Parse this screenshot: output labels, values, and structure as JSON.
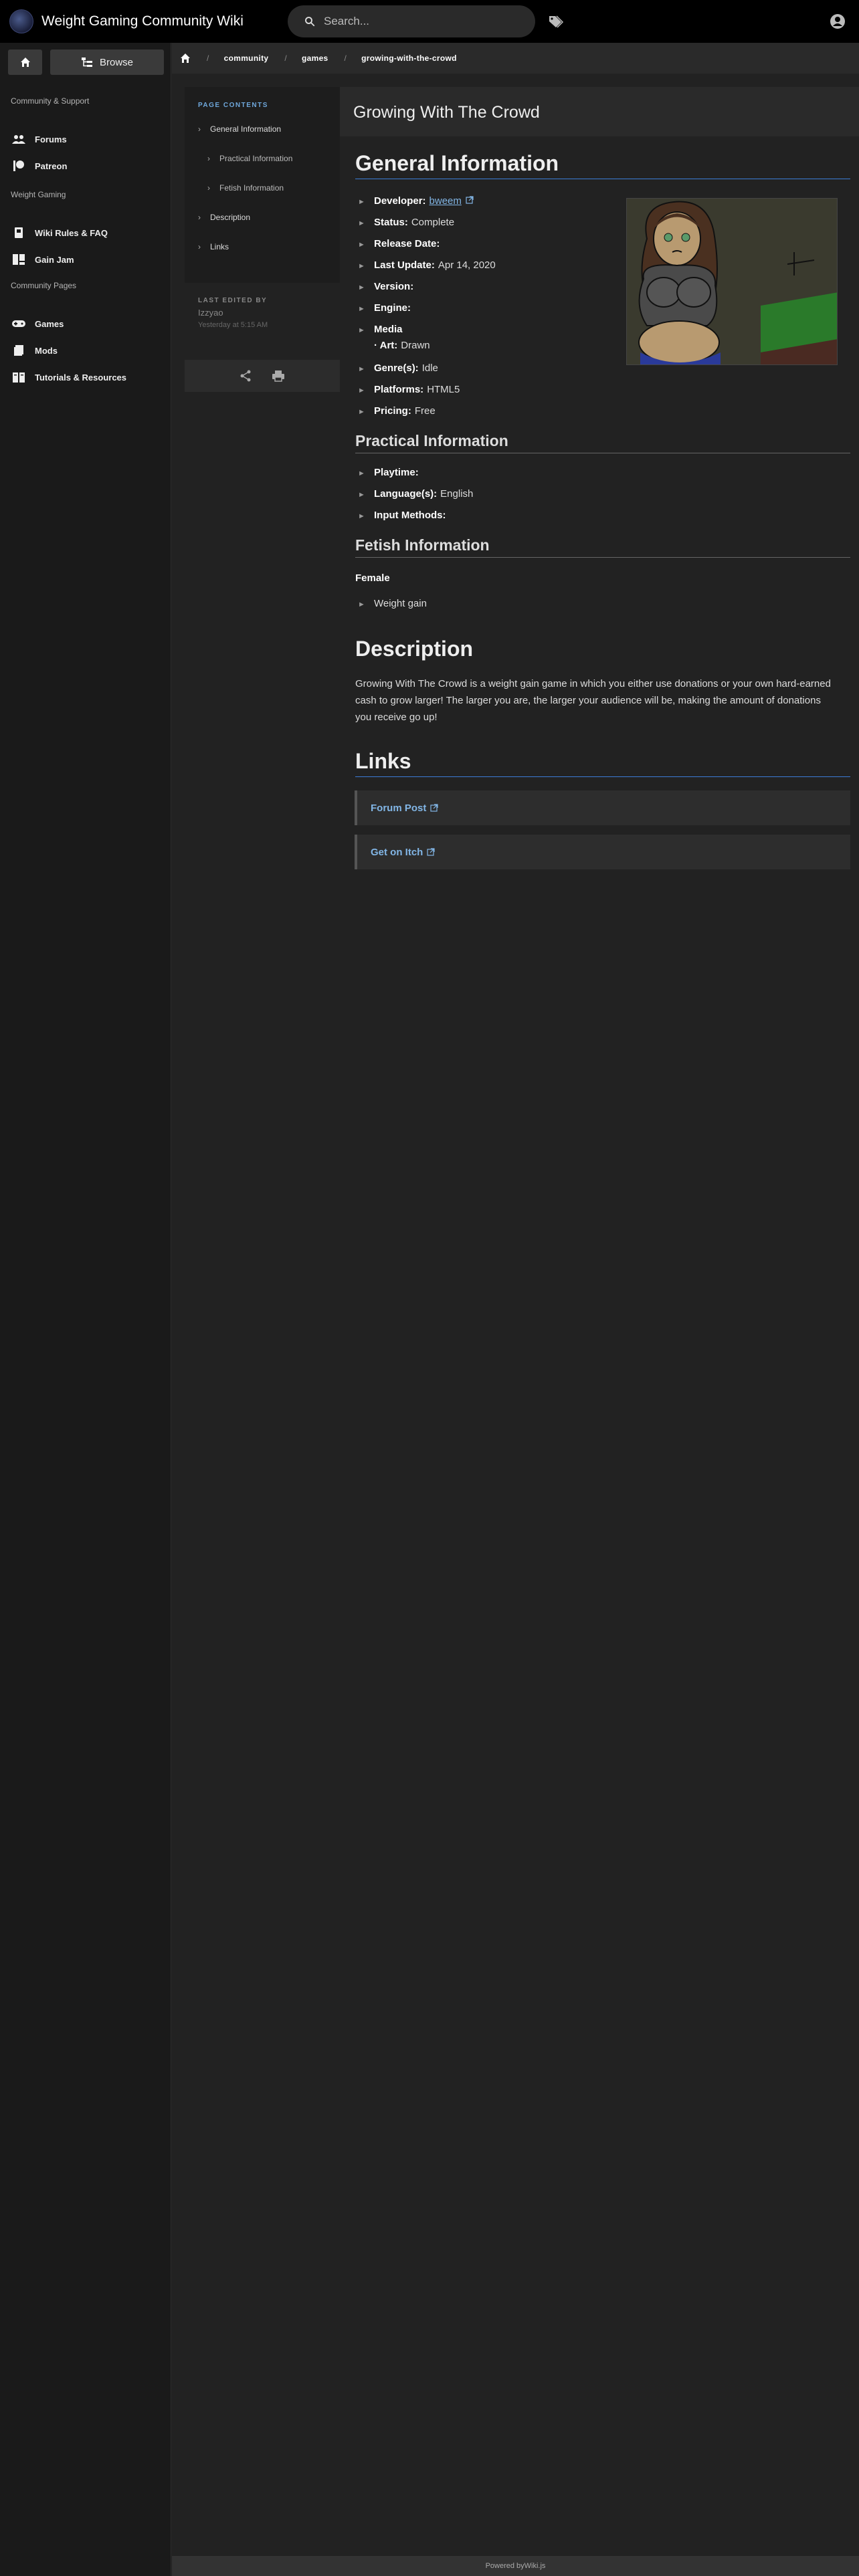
{
  "header": {
    "site_title": "Weight Gaming Community Wiki",
    "search_placeholder": "Search..."
  },
  "sidebar": {
    "browse_label": "Browse",
    "groups": [
      {
        "header": "Community & Support",
        "items": [
          {
            "label": "Forums",
            "icon": "people-icon"
          },
          {
            "label": "Patreon",
            "icon": "patreon-icon"
          }
        ]
      },
      {
        "header": "Weight Gaming",
        "items": [
          {
            "label": "Wiki Rules & FAQ",
            "icon": "book-icon"
          },
          {
            "label": "Gain Jam",
            "icon": "jam-icon"
          }
        ]
      },
      {
        "header": "Community Pages",
        "items": [
          {
            "label": "Games",
            "icon": "gamepad-icon"
          },
          {
            "label": "Mods",
            "icon": "mods-icon"
          },
          {
            "label": "Tutorials & Resources",
            "icon": "tutorial-icon"
          }
        ]
      }
    ]
  },
  "breadcrumbs": [
    "community",
    "games",
    "growing-with-the-crowd"
  ],
  "toc": {
    "title": "PAGE CONTENTS",
    "items": [
      {
        "label": "General Information",
        "level": 1
      },
      {
        "label": "Practical Information",
        "level": 2
      },
      {
        "label": "Fetish Information",
        "level": 2
      },
      {
        "label": "Description",
        "level": 1
      },
      {
        "label": "Links",
        "level": 1
      }
    ],
    "last_edited_label": "LAST EDITED BY",
    "last_edited_user": "Izzyao",
    "last_edited_time": "Yesterday at 5:15 AM"
  },
  "page_title": "Growing With The Crowd",
  "general": {
    "heading": "General Information",
    "developer_label": "Developer:",
    "developer": "bweem",
    "status_label": "Status:",
    "status": "Complete",
    "release_label": "Release Date:",
    "update_label": "Last Update:",
    "update": "Apr 14, 2020",
    "version_label": "Version:",
    "engine_label": "Engine:",
    "media_label": "Media",
    "art_label": "· Art:",
    "art": "Drawn",
    "genre_label": "Genre(s):",
    "genre": "Idle",
    "platforms_label": "Platforms:",
    "platforms": "HTML5",
    "pricing_label": "Pricing:",
    "pricing": "Free"
  },
  "practical": {
    "heading": "Practical Information",
    "playtime_label": "Playtime:",
    "language_label": "Language(s):",
    "language": "English",
    "input_label": "Input Methods:"
  },
  "fetish": {
    "heading": "Fetish Information",
    "subheading": "Female",
    "item": "Weight gain"
  },
  "description": {
    "heading": "Description",
    "text": "Growing With The Crowd is a weight gain game in which you either use donations or your own hard-earned cash to grow larger! The larger you are, the larger your audience will be, making the amount of donations you receive go up!"
  },
  "links": {
    "heading": "Links",
    "items": [
      "Forum Post",
      "Get on Itch"
    ]
  },
  "footer": {
    "prefix": "Powered by",
    "brand": "Wiki.js"
  },
  "colors": {
    "accent": "#3b7dd8",
    "link": "#82b6e6"
  }
}
